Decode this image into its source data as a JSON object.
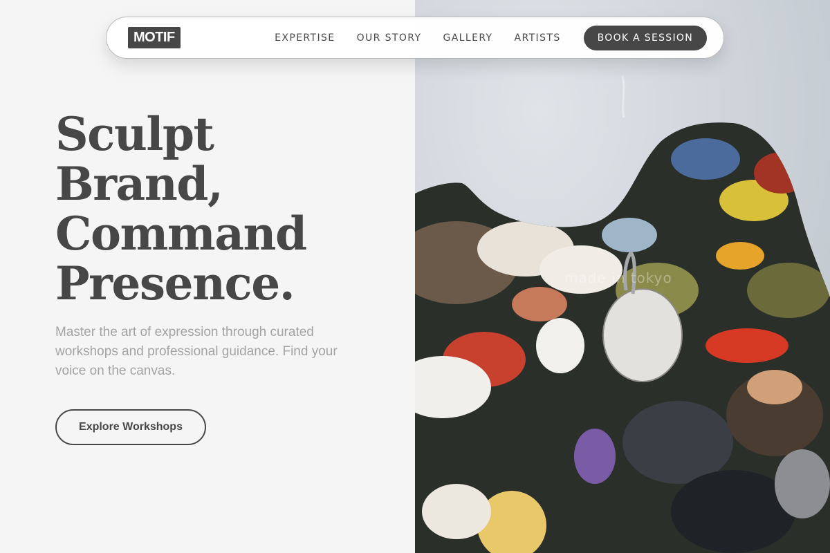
{
  "nav": {
    "logo": "MOTIF",
    "links": [
      "EXPERTISE",
      "OUR STORY",
      "GALLERY",
      "ARTISTS"
    ],
    "cta": "BOOK A SESSION"
  },
  "hero": {
    "headline": [
      "Sculpt",
      "Brand,",
      "Command",
      "Presence."
    ],
    "subtext": "Master the art of expression through curated workshops and professional guidance. Find your voice on the canvas.",
    "button": "Explore Workshops",
    "image_alt": "Paint palette covered in thick oil paint",
    "watermark": "made in tokyo"
  },
  "colors": {
    "primary": "#474747",
    "background": "#f5f5f5",
    "muted_text": "#a3a3a3"
  }
}
